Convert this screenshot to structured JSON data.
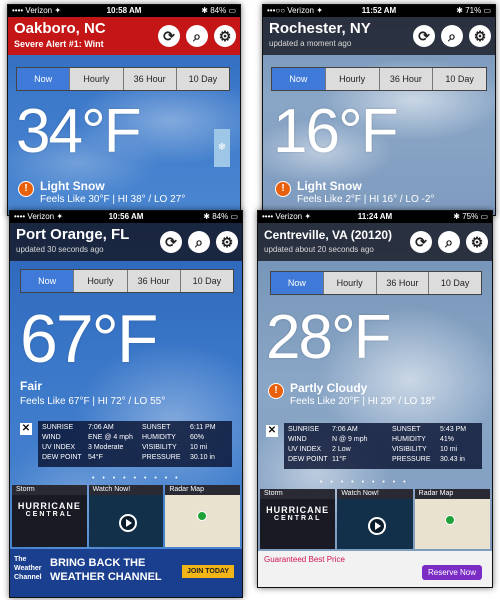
{
  "screens": [
    {
      "status": {
        "carrier": "•••• Verizon ✦",
        "time": "10:58 AM",
        "battery": "✱ 84% ▭"
      },
      "city": "Oakboro, NC",
      "subtitle": "Severe Alert #1: Wint",
      "tabs": [
        "Now",
        "Hourly",
        "36 Hour",
        "10 Day"
      ],
      "temp": "34°F",
      "condition": "Light Snow",
      "feels": "Feels Like 30°F | HI 38° / LO 27°"
    },
    {
      "status": {
        "carrier": "•••○○ Verizon ✦",
        "time": "11:52 AM",
        "battery": "✱ 71% ▭"
      },
      "city": "Rochester, NY",
      "subtitle": "updated a moment ago",
      "tabs": [
        "Now",
        "Hourly",
        "36 Hour",
        "10 Day"
      ],
      "temp": "16°F",
      "condition": "Light Snow",
      "feels": "Feels Like 2°F | HI 16° / LO -2°"
    },
    {
      "status": {
        "carrier": "•••• Verizon ✦",
        "time": "10:56 AM",
        "battery": "✱ 84% ▭"
      },
      "city": "Port Orange, FL",
      "subtitle": "updated 30 seconds ago",
      "tabs": [
        "Now",
        "Hourly",
        "36 Hour",
        "10 Day"
      ],
      "temp": "67°F",
      "condition": "Fair",
      "feels": "Feels Like 67°F | HI 72° / LO 55°",
      "details": {
        "sunrise_label": "SUNRISE",
        "sunrise": "7:06 AM",
        "sunset_label": "SUNSET",
        "sunset": "6:11 PM",
        "wind_label": "WIND",
        "wind": "ENE @ 4 mph",
        "humidity_label": "HUMIDITY",
        "humidity": "60%",
        "uv_label": "UV INDEX",
        "uv": "3 Moderate",
        "visibility_label": "VISIBILITY",
        "visibility": "10 mi",
        "dew_label": "DEW POINT",
        "dew": "54°F",
        "pressure_label": "PRESSURE",
        "pressure": "30.10 in"
      },
      "cards": [
        "Storm",
        "Watch Now!",
        "Radar Map"
      ],
      "hurricane": "HURRICANE",
      "central": "CENTRAL",
      "ad": {
        "brand": "The Weather Channel",
        "line1": "BRING BACK THE",
        "line2": "WEATHER CHANNEL",
        "cta": "JOIN TODAY"
      }
    },
    {
      "status": {
        "carrier": "•••• Verizon ✦",
        "time": "11:24 AM",
        "battery": "✱ 75% ▭"
      },
      "city": "Centreville, VA (20120)",
      "subtitle": "updated about 20 seconds ago",
      "tabs": [
        "Now",
        "Hourly",
        "36 Hour",
        "10 Day"
      ],
      "temp": "28°F",
      "condition": "Partly Cloudy",
      "feels": "Feels Like 20°F | HI 29° / LO 18°",
      "details": {
        "sunrise_label": "SUNRISE",
        "sunrise": "7:06 AM",
        "sunset_label": "SUNSET",
        "sunset": "5:43 PM",
        "wind_label": "WIND",
        "wind": "N @ 9 mph",
        "humidity_label": "HUMIDITY",
        "humidity": "41%",
        "uv_label": "UV INDEX",
        "uv": "2 Low",
        "visibility_label": "VISIBILITY",
        "visibility": "10 mi",
        "dew_label": "DEW POINT",
        "dew": "11°F",
        "pressure_label": "PRESSURE",
        "pressure": "30.43 in"
      },
      "cards": [
        "Storm",
        "Watch Now!",
        "Radar Map"
      ],
      "hurricane": "HURRICANE",
      "central": "CENTRAL",
      "ad": {
        "line1": "Guaranteed Best Price",
        "cta": "Reserve Now"
      }
    }
  ],
  "icons": {
    "refresh": "refresh-icon",
    "search": "search-icon",
    "settings": "gear-icon"
  }
}
